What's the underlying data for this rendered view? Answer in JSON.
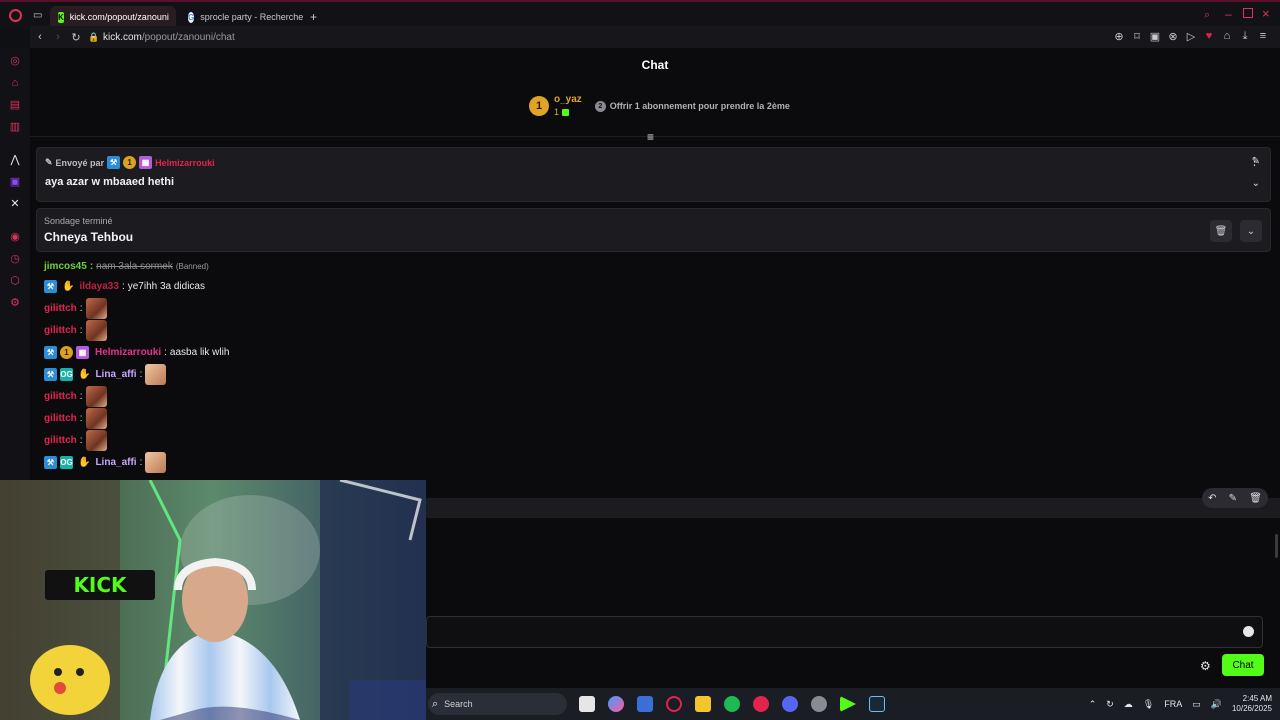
{
  "browser": {
    "tabs": [
      {
        "label": "kick.com/popout/zanouni",
        "active": true
      },
      {
        "label": "sprocle party - Recherche",
        "active": false
      }
    ],
    "url_host": "kick.com",
    "url_path": "/popout/zanouni/chat"
  },
  "chat": {
    "title": "Chat",
    "gifter": {
      "rank": "1",
      "name": "o_yaz",
      "count": "1"
    },
    "gift_offer": {
      "badge": "2",
      "text": "Offrir 1 abonnement pour prendre la 2ème"
    },
    "pinned": {
      "sent_by_label": "Envoyé par",
      "user": "Helmizarrouki",
      "badge_num": "1",
      "message": "aya azar w mbaaed hethi"
    },
    "poll": {
      "status": "Sondage terminé",
      "title": "Chneya Tehbou"
    },
    "messages": [
      {
        "user": "jimcos45",
        "text": "nam 3ala sormek",
        "tag": "(Banned)"
      },
      {
        "user": "ildaya33",
        "text": "ye7ihh 3a didicas"
      },
      {
        "user": "gilittch",
        "text": ""
      },
      {
        "user": "gilittch",
        "text": ""
      },
      {
        "user": "Helmizarrouki",
        "text": "aasba lik wlih",
        "badge_num": "1"
      },
      {
        "user": "Lina_affi",
        "text": ""
      },
      {
        "user": "gilittch",
        "text": ""
      },
      {
        "user": "gilittch",
        "text": ""
      },
      {
        "user": "gilittch",
        "text": ""
      },
      {
        "user": "Lina_affi",
        "text": ""
      }
    ],
    "send_label": "Chat"
  },
  "taskbar": {
    "search_placeholder": "Search",
    "language": "FRA",
    "time": "2:45 AM",
    "date": "10/26/2025"
  },
  "colors": {
    "kick_green": "#53fc18",
    "accent_red": "#e0244e"
  }
}
